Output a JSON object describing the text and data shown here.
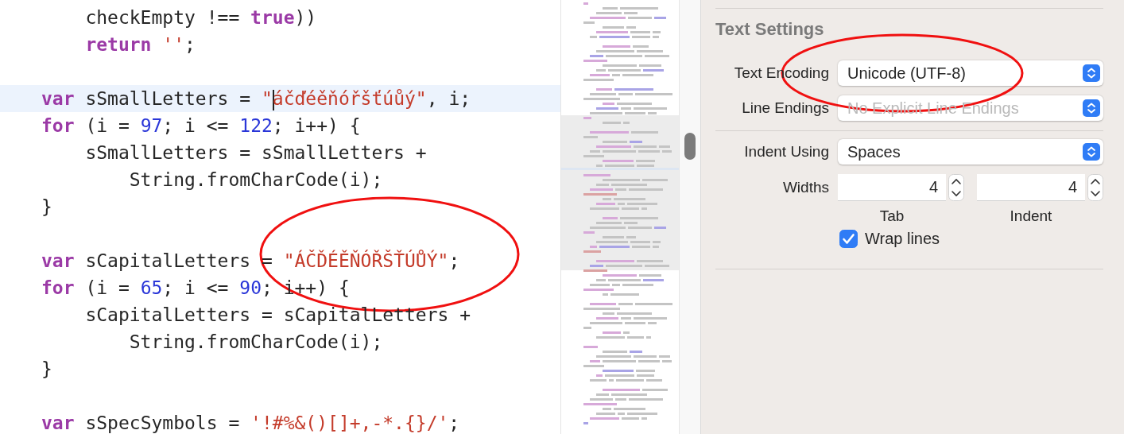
{
  "editor": {
    "lines": [
      {
        "kind": "code",
        "current": false,
        "tokens": [
          {
            "kind": "plain",
            "text": "    checkEmpty !== "
          },
          {
            "kind": "keyword",
            "text": "true"
          },
          {
            "kind": "plain",
            "text": "))"
          }
        ]
      },
      {
        "kind": "code",
        "current": false,
        "tokens": [
          {
            "kind": "keyword",
            "text": "    return "
          },
          {
            "kind": "string",
            "text": "''"
          },
          {
            "kind": "plain",
            "text": ";"
          }
        ]
      },
      {
        "kind": "blank",
        "current": false
      },
      {
        "kind": "code",
        "current": true,
        "tokens": [
          {
            "kind": "keyword",
            "text": "var"
          },
          {
            "kind": "plain",
            "text": " sSmallLetters = "
          },
          {
            "kind": "string",
            "text": "\""
          },
          {
            "kind": "string",
            "text": "áčďéěňóřšťúůý\"",
            "caret_before": true
          },
          {
            "kind": "plain",
            "text": ", i;"
          }
        ]
      },
      {
        "kind": "code",
        "current": false,
        "tokens": [
          {
            "kind": "keyword",
            "text": "for"
          },
          {
            "kind": "plain",
            "text": " (i = "
          },
          {
            "kind": "number",
            "text": "97"
          },
          {
            "kind": "plain",
            "text": "; i <= "
          },
          {
            "kind": "number",
            "text": "122"
          },
          {
            "kind": "plain",
            "text": "; i++) {"
          }
        ]
      },
      {
        "kind": "code",
        "current": false,
        "tokens": [
          {
            "kind": "plain",
            "text": "    sSmallLetters = sSmallLetters +"
          }
        ]
      },
      {
        "kind": "code",
        "current": false,
        "tokens": [
          {
            "kind": "plain",
            "text": "        String.fromCharCode(i);"
          }
        ]
      },
      {
        "kind": "code",
        "current": false,
        "tokens": [
          {
            "kind": "plain",
            "text": "}"
          }
        ]
      },
      {
        "kind": "blank",
        "current": false
      },
      {
        "kind": "code",
        "current": false,
        "tokens": [
          {
            "kind": "keyword",
            "text": "var"
          },
          {
            "kind": "plain",
            "text": " sCapitalLetters = "
          },
          {
            "kind": "string",
            "text": "\"ÁČĎÉĚŇÓŘŠŤÚŮÝ\""
          },
          {
            "kind": "plain",
            "text": ";"
          }
        ]
      },
      {
        "kind": "code",
        "current": false,
        "tokens": [
          {
            "kind": "keyword",
            "text": "for"
          },
          {
            "kind": "plain",
            "text": " (i = "
          },
          {
            "kind": "number",
            "text": "65"
          },
          {
            "kind": "plain",
            "text": "; i <= "
          },
          {
            "kind": "number",
            "text": "90"
          },
          {
            "kind": "plain",
            "text": "; i++) {"
          }
        ]
      },
      {
        "kind": "code",
        "current": false,
        "tokens": [
          {
            "kind": "plain",
            "text": "    sCapitalLetters = sCapitalLetters +"
          }
        ]
      },
      {
        "kind": "code",
        "current": false,
        "tokens": [
          {
            "kind": "plain",
            "text": "        String.fromCharCode(i);"
          }
        ]
      },
      {
        "kind": "code",
        "current": false,
        "tokens": [
          {
            "kind": "plain",
            "text": "}"
          }
        ]
      },
      {
        "kind": "blank",
        "current": false
      },
      {
        "kind": "code",
        "current": false,
        "tokens": [
          {
            "kind": "keyword",
            "text": "var"
          },
          {
            "kind": "plain",
            "text": " sSpecSymbols = "
          },
          {
            "kind": "string",
            "text": "'!#%&()[]+,-*.{}/'"
          },
          {
            "kind": "plain",
            "text": ";"
          }
        ]
      }
    ]
  },
  "inspector": {
    "section_title": "Text Settings",
    "popups": [
      {
        "label": "Text Encoding",
        "value": "Unicode (UTF-8)",
        "disabled": false
      },
      {
        "label": "Line Endings",
        "value": "No Explicit Line Endings",
        "disabled": true
      },
      {
        "label": "Indent Using",
        "value": "Spaces",
        "disabled": false
      }
    ],
    "widths": {
      "label": "Widths",
      "fields": [
        {
          "value": "4",
          "caption": "Tab"
        },
        {
          "value": "4",
          "caption": "Indent"
        }
      ]
    },
    "wrap_lines": {
      "label": "Wrap lines",
      "checked": true
    }
  }
}
